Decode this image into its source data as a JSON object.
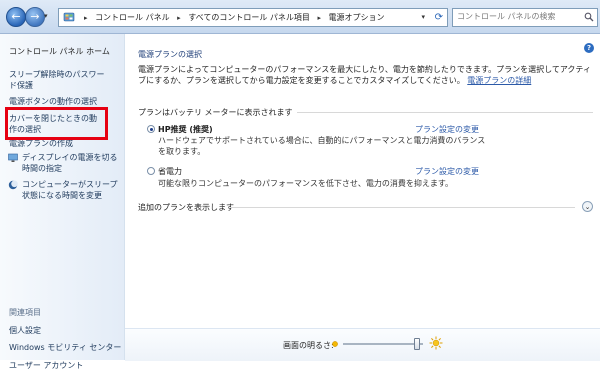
{
  "address_bar": {
    "crumbs": [
      "コントロール パネル",
      "すべてのコントロール パネル項目",
      "電源オプション"
    ]
  },
  "search": {
    "placeholder": "コントロール パネルの検索"
  },
  "sidebar": {
    "home": "コントロール パネル ホーム",
    "links": [
      "スリープ解除時のパスワード保護",
      "電源ボタンの動作の選択",
      "カバーを閉じたときの動作の選択",
      "電源プランの作成",
      "ディスプレイの電源を切る時間の指定",
      "コンピューターがスリープ状態になる時間を変更"
    ],
    "related_heading": "関連項目",
    "related": [
      "個人設定",
      "Windows モビリティ センター",
      "ユーザー アカウント"
    ]
  },
  "main": {
    "title": "電源プランの選択",
    "description": "電源プランによってコンピューターのパフォーマンスを最大にしたり、電力を節約したりできます。プランを選択してアクティブにするか、プランを選択してから電力設定を変更することでカスタマイズしてください。",
    "more_link": "電源プランの詳細",
    "group_heading": "プランはバッテリ メーターに表示されます",
    "plans": [
      {
        "name": "HP推奨 (推奨)",
        "description": "ハードウェアでサポートされている場合に、自動的にパフォーマンスと電力消費のバランスを取ります。",
        "link": "プラン設定の変更",
        "selected": true
      },
      {
        "name": "省電力",
        "description": "可能な限りコンピューターのパフォーマンスを低下させ、電力の消費を抑えます。",
        "link": "プラン設定の変更",
        "selected": false
      }
    ],
    "show_more": "追加のプランを表示します"
  },
  "bottom": {
    "brightness_label": "画面の明るさ:",
    "brightness_level": 0.93
  },
  "colors": {
    "highlight_box": "#e60012",
    "link": "#2c5aa8",
    "title": "#1e3e78"
  }
}
